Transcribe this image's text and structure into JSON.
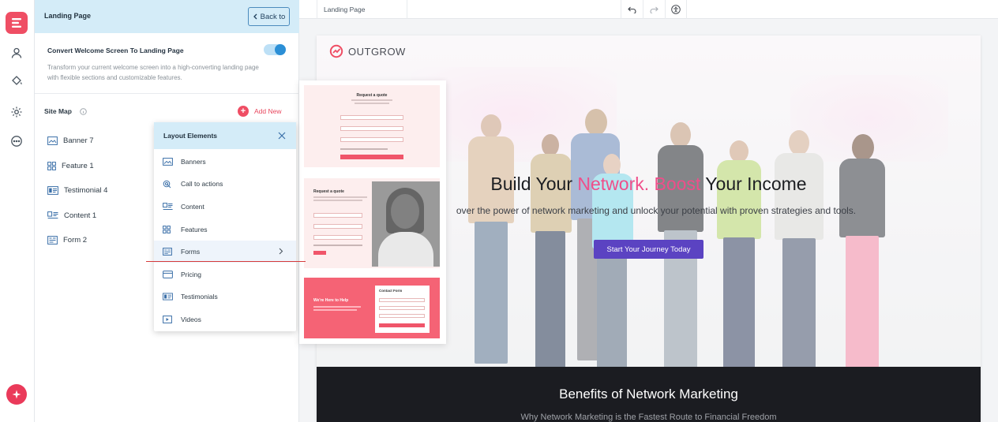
{
  "panel": {
    "title": "Landing Page",
    "back_label": "Back to",
    "convert_title": "Convert Welcome Screen To Landing Page",
    "convert_desc": "Transform your current welcome screen into a high-converting landing page with flexible sections and customizable features.",
    "toggle_on": true,
    "sitemap_label": "Site Map",
    "add_new_label": "Add New",
    "sitemap_items": [
      {
        "label": "Banner 7",
        "icon": "banner-icon"
      },
      {
        "label": "Feature 1",
        "icon": "feature-grid-icon"
      },
      {
        "label": "Testimonial 4",
        "icon": "testimonial-icon"
      },
      {
        "label": "Content 1",
        "icon": "content-icon"
      },
      {
        "label": "Form 2",
        "icon": "form-icon"
      }
    ]
  },
  "layout_elements": {
    "title": "Layout Elements",
    "items": [
      {
        "label": "Banners",
        "icon": "banner-icon"
      },
      {
        "label": "Call to actions",
        "icon": "call-to-action-icon"
      },
      {
        "label": "Content",
        "icon": "content-icon"
      },
      {
        "label": "Features",
        "icon": "feature-grid-icon"
      },
      {
        "label": "Forms",
        "icon": "form-icon",
        "active": true
      },
      {
        "label": "Pricing",
        "icon": "pricing-card-icon"
      },
      {
        "label": "Testimonials",
        "icon": "testimonial-icon"
      },
      {
        "label": "Videos",
        "icon": "video-icon"
      }
    ]
  },
  "form_templates": [
    {
      "title": "Request a quote",
      "layout": "centered"
    },
    {
      "title": "Request a quote",
      "layout": "with-photo"
    },
    {
      "title": "Contact Form",
      "heading": "We're Here to Help",
      "layout": "red-split"
    }
  ],
  "topbar": {
    "tab_label": "Landing Page",
    "undo_icon": "undo-icon",
    "redo_icon": "redo-icon",
    "accessibility_icon": "accessibility-icon"
  },
  "canvas": {
    "logo_text": "OUTGROW",
    "hero_title_a": "Build Your ",
    "hero_title_b": "Network. Boost",
    "hero_title_c": " Your Income",
    "hero_subtitle": "over the power of network marketing and unlock your potential with proven strategies and tools.",
    "hero_cta": "Start Your Journey Today",
    "benefits_title": "Benefits of Network Marketing",
    "benefits_subtitle": "Why Network Marketing is the Fastest Route to Financial Freedom"
  },
  "colors": {
    "accent_red": "#ef4e64",
    "header_blue": "#d4ecf8",
    "cta_purple": "#5b43c2",
    "highlight_pink": "#ef4e8a"
  }
}
